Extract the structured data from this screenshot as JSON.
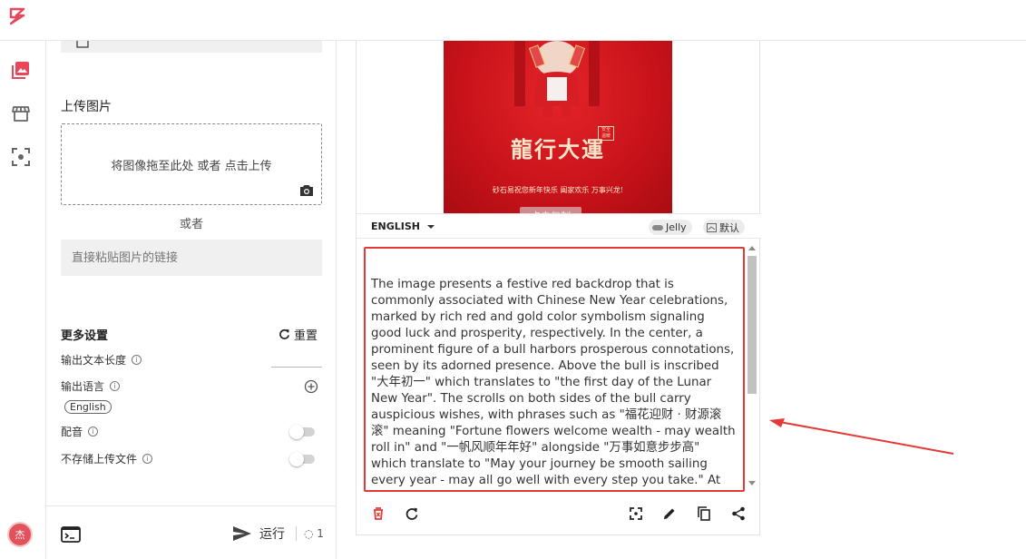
{
  "panel": {
    "upload_title": "上传图片",
    "dropzone_text": "将图像拖至此处 或者 点击上传",
    "or_text": "或者",
    "url_placeholder": "直接粘贴图片的链接",
    "more_settings": "更多设置",
    "reset_label": "重置",
    "output_length_label": "输出文本长度",
    "output_language_label": "输出语言",
    "language_chip": "English",
    "voice_label": "配音",
    "no_store_label": "不存储上传文件",
    "run_label": "运行",
    "credit_value": "1"
  },
  "avatar": {
    "text": "杰"
  },
  "result": {
    "poster_title": "龍行大運",
    "poster_greeting": "砂石易祝您新年快乐 阖家欢乐 万事兴龙!",
    "copy_hint": "点击复制",
    "language": "ENGLISH",
    "tags": [
      "Jelly",
      "默认"
    ],
    "description": "The image presents a festive red backdrop that is commonly associated with Chinese New Year celebrations, marked by rich red and gold color symbolism signaling good luck and prosperity, respectively. In the center, a prominent figure of a bull harbors prosperous connotations, seen by its adorned presence. Above the bull is inscribed \"大年初一\" which translates to \"the first day of the Lunar New Year\". The scrolls on both sides of the bull carry auspicious wishes, with phrases such as \"福花迎财 · 财源滚滚\" meaning \"Fortune flowers welcome wealth - may wealth roll in\" and \"一帆风顺年年好\" alongside \"万事如意步步高\" which translate to \"May your journey be smooth sailing every year - may all go well with every step you take.\" At the top, the text \"HAPPY SPRING FESTIVAL\" conveys festive greetings, whereas the bottom of"
  },
  "colors": {
    "accent_red": "#e53935",
    "brand_red": "#e2525c"
  },
  "icons": [
    "logo-icon",
    "image-gallery-icon",
    "store-icon",
    "scan-icon",
    "camera-icon",
    "refresh-icon",
    "info-icon",
    "add-circle-icon",
    "terminal-icon",
    "send-icon",
    "delete-icon",
    "fullscreen-icon",
    "edit-icon",
    "copy-icon",
    "share-icon"
  ]
}
